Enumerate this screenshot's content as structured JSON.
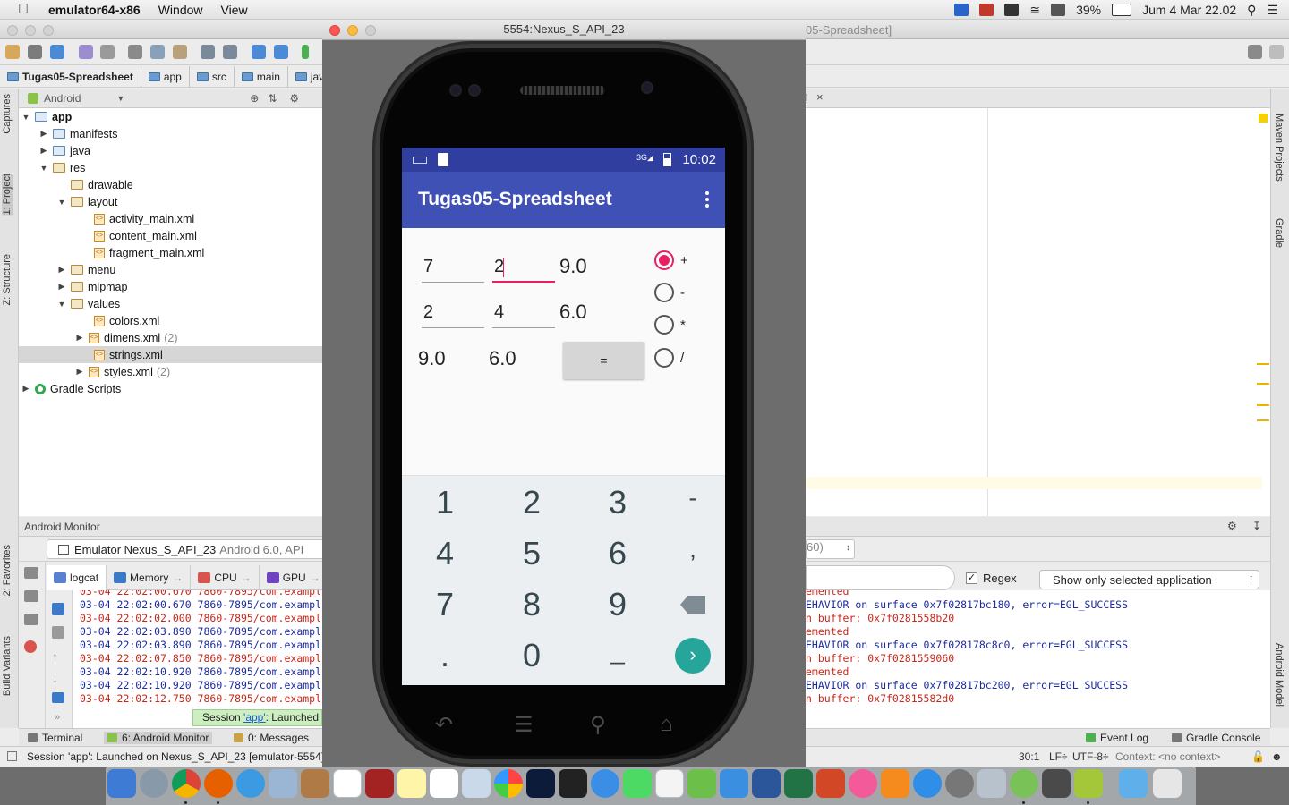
{
  "menubar": {
    "app_name": "emulator64-x86",
    "items": [
      "Window",
      "View"
    ],
    "battery": "39%",
    "datetime": "Jum 4 Mar  22.02"
  },
  "ide": {
    "title_suffix": "05-Spreadsheet]",
    "breadcrumb": [
      "Tugas05-Spreadsheet",
      "app",
      "src",
      "main",
      "java"
    ],
    "left_tabs": [
      "Captures",
      "1: Project",
      "Z: Structure",
      "2: Favorites",
      "Build Variants"
    ],
    "right_tabs": [
      "Maven Projects",
      "Gradle",
      "Android Model"
    ],
    "project_view": "Android",
    "tree": [
      {
        "label": "app",
        "hint": ""
      },
      {
        "label": "manifests",
        "hint": ""
      },
      {
        "label": "java",
        "hint": ""
      },
      {
        "label": "res",
        "hint": ""
      },
      {
        "label": "drawable",
        "hint": ""
      },
      {
        "label": "layout",
        "hint": ""
      },
      {
        "label": "activity_main.xml",
        "hint": ""
      },
      {
        "label": "content_main.xml",
        "hint": ""
      },
      {
        "label": "fragment_main.xml",
        "hint": ""
      },
      {
        "label": "menu",
        "hint": ""
      },
      {
        "label": "mipmap",
        "hint": ""
      },
      {
        "label": "values",
        "hint": ""
      },
      {
        "label": "colors.xml",
        "hint": ""
      },
      {
        "label": "dimens.xml",
        "hint": "(2)"
      },
      {
        "label": "strings.xml",
        "hint": ""
      },
      {
        "label": "styles.xml",
        "hint": "(2)"
      },
      {
        "label": "Gradle Scripts",
        "hint": ""
      }
    ],
    "editor_tab_suffix": "l",
    "android_monitor": {
      "title": "Android Monitor",
      "device": "Emulator Nexus_S_API_23",
      "device_os": "Android 6.0, API",
      "process_suffix": "60)",
      "tabs": [
        "logcat",
        "Memory",
        "CPU",
        "GPU"
      ],
      "regex_label": "Regex",
      "filter_select": "Show only selected application",
      "log_left": [
        "03-04 22:02:00.670 7860-7895/com.exampl",
        "03-04 22:02:00.670 7860-7895/com.exampl",
        "03-04 22:02:02.000 7860-7895/com.exampl",
        "03-04 22:02:03.890 7860-7895/com.exampl",
        "03-04 22:02:03.890 7860-7895/com.exampl",
        "03-04 22:02:07.850 7860-7895/com.exampl",
        "03-04 22:02:10.920 7860-7895/com.exampl",
        "03-04 22:02:10.920 7860-7895/com.exampl",
        "03-04 22:02:12.750 7860-7895/com.exampl"
      ],
      "log_right": [
        "emented",
        "EHAVIOR on surface 0x7f02817bc180, error=EGL_SUCCESS",
        "n buffer: 0x7f0281558b20",
        "emented",
        "EHAVIOR on surface 0x7f028178c8c0, error=EGL_SUCCESS",
        "n buffer: 0x7f0281559060",
        "emented",
        "EHAVIOR on surface 0x7f02817bc200, error=EGL_SUCCESS",
        "n buffer: 0x7f02815582d0"
      ],
      "session_popup_prefix": "Session ",
      "session_popup_link": "'app'",
      "session_popup_suffix": ": Launched o"
    },
    "bottom_tabs": [
      "Terminal",
      "6: Android Monitor",
      "0: Messages",
      "Event Log",
      "Gradle Console"
    ],
    "status": {
      "message": "Session 'app': Launched on Nexus_S_API_23 [emulator-5554]",
      "position": "30:1",
      "line_sep": "LF÷",
      "encoding": "UTF-8÷",
      "context": "Context: <no context>"
    }
  },
  "emulator": {
    "title": "5554:Nexus_S_API_23",
    "status_time": "10:02",
    "app_title": "Tugas05-Spreadsheet",
    "inputs": {
      "a1": "7",
      "b1": "2",
      "a2": "2",
      "b2": "4"
    },
    "results": {
      "r1": "9.0",
      "r2": "6.0",
      "c1": "9.0",
      "c2": "6.0"
    },
    "equals_label": "=",
    "operators": [
      "+",
      "-",
      "*",
      "/"
    ],
    "selected_operator": "+",
    "keypad": [
      "1",
      "2",
      "3",
      "-",
      "4",
      "5",
      "6",
      ",",
      "7",
      "8",
      "9",
      ".",
      "0",
      "_"
    ]
  },
  "colors": {
    "primary": "#3f51b5",
    "primary_dark": "#303f9f",
    "accent": "#e91e63",
    "go_button": "#26a69a"
  }
}
